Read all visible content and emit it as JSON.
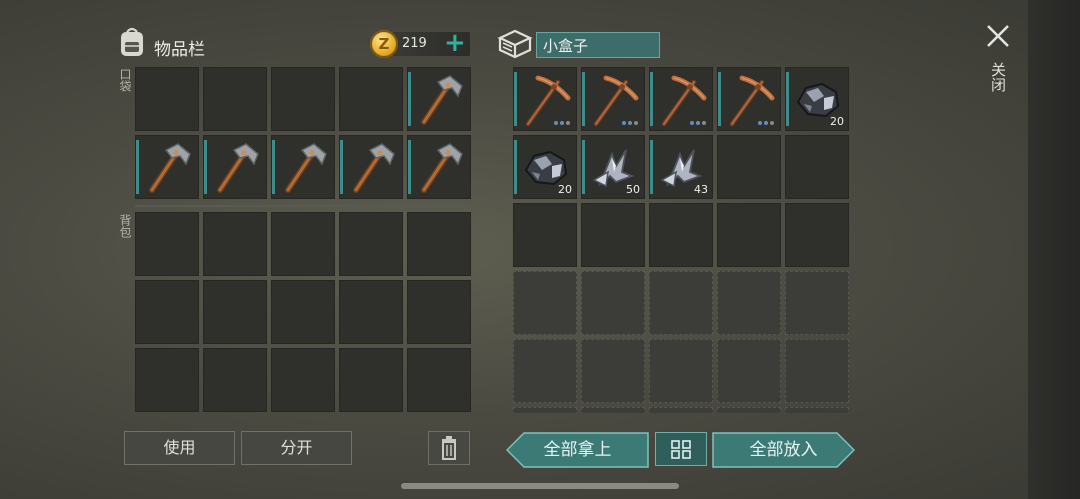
{
  "inventory": {
    "title": "物品栏",
    "coins": "219",
    "coin_symbol": "Z",
    "add_coins": "+",
    "pocket_label": "口袋",
    "backpack_label": "背包",
    "pocket_slots": [
      {
        "item": "",
        "qty": ""
      },
      {
        "item": "",
        "qty": ""
      },
      {
        "item": "",
        "qty": ""
      },
      {
        "item": "",
        "qty": ""
      },
      {
        "item": "stone-hammer",
        "qty": ""
      },
      {
        "item": "stone-hammer",
        "qty": ""
      },
      {
        "item": "stone-hammer",
        "qty": ""
      },
      {
        "item": "stone-hammer",
        "qty": ""
      },
      {
        "item": "stone-hammer",
        "qty": ""
      },
      {
        "item": "stone-hammer",
        "qty": ""
      }
    ],
    "backpack_slots": 15
  },
  "container": {
    "name": "小盒子",
    "slots": [
      {
        "item": "copper-pickaxe",
        "qty": "",
        "dots": true
      },
      {
        "item": "copper-pickaxe",
        "qty": "",
        "dots": true
      },
      {
        "item": "copper-pickaxe",
        "qty": "",
        "dots": true
      },
      {
        "item": "copper-pickaxe",
        "qty": "",
        "dots": true
      },
      {
        "item": "iron-ore",
        "qty": "20",
        "dots": false
      },
      {
        "item": "iron-ore",
        "qty": "20",
        "dots": false
      },
      {
        "item": "iron-scrap",
        "qty": "50",
        "dots": false
      },
      {
        "item": "iron-scrap",
        "qty": "43",
        "dots": false
      }
    ],
    "total_slots": 30,
    "locked_from": 15
  },
  "actions": {
    "use": "使用",
    "split": "分开",
    "take_all": "全部拿上",
    "put_all": "全部放入",
    "close": "关闭"
  },
  "colors": {
    "accent_teal": "#3f8c8c",
    "coin_gold": "#e0a820"
  }
}
